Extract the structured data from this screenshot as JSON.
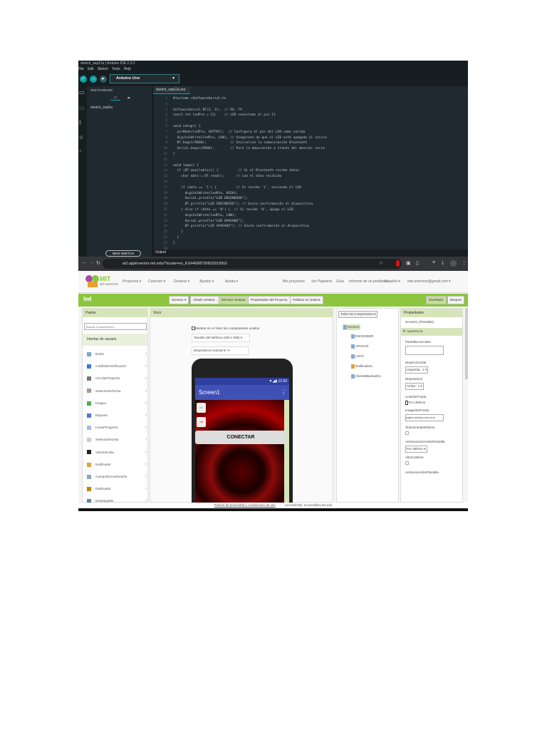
{
  "ide": {
    "title": "sketch_sep11a | Arduino IDE 2.3.2",
    "menu": [
      "File",
      "Edit",
      "Sketch",
      "Tools",
      "Help"
    ],
    "board": "Arduino Uno",
    "sidebar_title": "SKETCHBOOK",
    "sketch_item": "sketch_sep5a",
    "tab": "sketch_sep11a.ino",
    "code": [
      "#include <SoftwareSerial.h>",
      "",
      "SoftwareSerial BT(2, 3);  // RX, TX",
      "const int ledPin = 13;    // LED conectado al pin 13",
      "",
      "void setup() {",
      "  pinMode(ledPin, OUTPUT);  // Configura el pin del LED como salida",
      "  digitalWrite(ledPin, LOW); // Asegúrate de que el LED esté apagado al inicio",
      "  BT.begin(9600);            // Inicializa la comunicación Bluetooth",
      "  Serial.begin(9600);        // Para la depuración a través del monitor serie",
      "}",
      "",
      "void loop() {",
      "  if (BT.available()) {          // Si el Bluetooth recibe datos",
      "    char dato = BT.read();      // Lee el dato recibido",
      "",
      "    if (dato == '1') {          // Si recibe '1', enciende el LED",
      "      digitalWrite(ledPin, HIGH);",
      "      Serial.println(\"LED ENCENDIDO\");",
      "      BT.println(\"LED ENCENDIDO\"); // Envía confirmación al dispositivo",
      "    } else if (dato == '0') {  // Si recibe '0', apaga el LED",
      "      digitalWrite(ledPin, LOW);",
      "      Serial.println(\"LED APAGADO\");",
      "      BT.println(\"LED APAGADO\"); // Envía confirmación al dispositivo",
      "    }",
      "  }",
      "}",
      ""
    ],
    "output_label": "Output",
    "new_sketch": "NEW SKETCH"
  },
  "browser": {
    "url": "ai2.appinventor.mit.edu/?locale=es_ES#4698700832919552",
    "logo": "MIT APP INVENTOR",
    "nav": [
      "Proyectos ▾",
      "Conector ▾",
      "Generar ▾",
      "Ajustes ▾",
      "Ayuda ▾"
    ],
    "nav_right": [
      "Mis proyectos",
      "Ver Papelera",
      "Guía",
      "Informar de un problema",
      "Español ▾",
      "imb.emerson@gmail.com ▾"
    ],
    "project": "led",
    "toolbar": [
      "Screen1 ▾",
      "Añadir ventana ...",
      "Eliminar ventana",
      "Propiedades del Proyecto",
      "Publicar en Galería"
    ],
    "toolbar_right": [
      "Diseñador",
      "Bloques"
    ],
    "palette": {
      "title": "Paleta",
      "search_placeholder": "Buscar Componentes...",
      "section": "Interfaz de usuario",
      "items": [
        "Botón",
        "CasillaDeVerificación",
        "CircularProgress",
        "SelectorDeFecha",
        "Imagen",
        "Etiqueta",
        "LinearProgress",
        "SelectorDeLista",
        "VisorDeLista",
        "Notificador",
        "CampoDeContraseña",
        "Deslizador",
        "Desplegable"
      ]
    },
    "viewer": {
      "title": "Visor",
      "checkbox_label": "Mostrar en el Visor los componentes ocultos",
      "size_select": "Tamaño del teléfono (320 x 505)",
      "device_select": "Dispositivos Android 5+",
      "time": "12:30",
      "screen_title": "Screen1",
      "btn_on": "on",
      "btn_off": "off",
      "connect": "CONECTAR"
    },
    "components": {
      "dropdown": "Todos los Componentes ▾",
      "tree": [
        "Screen1",
        "ENCENDER",
        "APAGAR",
        "LISTA",
        "Notificador1",
        "ClienteBluetooth1"
      ]
    },
    "properties": {
      "title": "Propiedades",
      "component": "Screen1 (Pantalla)",
      "section": "▼ Apariencia",
      "about": "PantallaAcercaDe",
      "halign": "DispHorizontal",
      "halign_val": "Izquierda : 1 ▾",
      "valign": "DispVertical",
      "valign_val": "Arriba : 1 ▾",
      "bg": "ColorDeFondo",
      "bg_val": "Por defecto",
      "bgimg": "ImagenDeFondo",
      "bgimg_val": "pngtree-abstract-cool-red-te",
      "bigtext": "TextoGrandeDefecto",
      "closeanim": "AnimacionCierreDePantalla",
      "closeanim_val": "Por defecto ▾",
      "height": "AltoContiene",
      "openanim": "AnimacionAbrirPantalla"
    },
    "footer": {
      "privacy": "Política de privacidad y condiciones de uso",
      "access": "Accessibility: accessibility.mit.edu"
    }
  },
  "colors": {
    "arduino_teal": "#0ca1a6",
    "ai_green": "#8cc63f",
    "app_bar": "#3f51b5"
  }
}
